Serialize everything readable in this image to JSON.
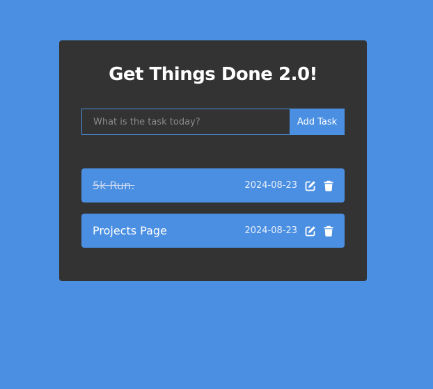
{
  "app": {
    "title": "Get Things Done 2.0!"
  },
  "form": {
    "placeholder": "What is the task today?",
    "value": "",
    "add_label": "Add Task"
  },
  "tasks": [
    {
      "text": "5k Run.",
      "date": "2024-08-23",
      "completed": true
    },
    {
      "text": "Projects Page",
      "date": "2024-08-23",
      "completed": false
    }
  ],
  "colors": {
    "background": "#4a8fe2",
    "card": "#333333",
    "accent": "#4a8fe2",
    "text": "#ffffff"
  },
  "icons": {
    "edit": "edit-icon",
    "delete": "trash-icon"
  }
}
